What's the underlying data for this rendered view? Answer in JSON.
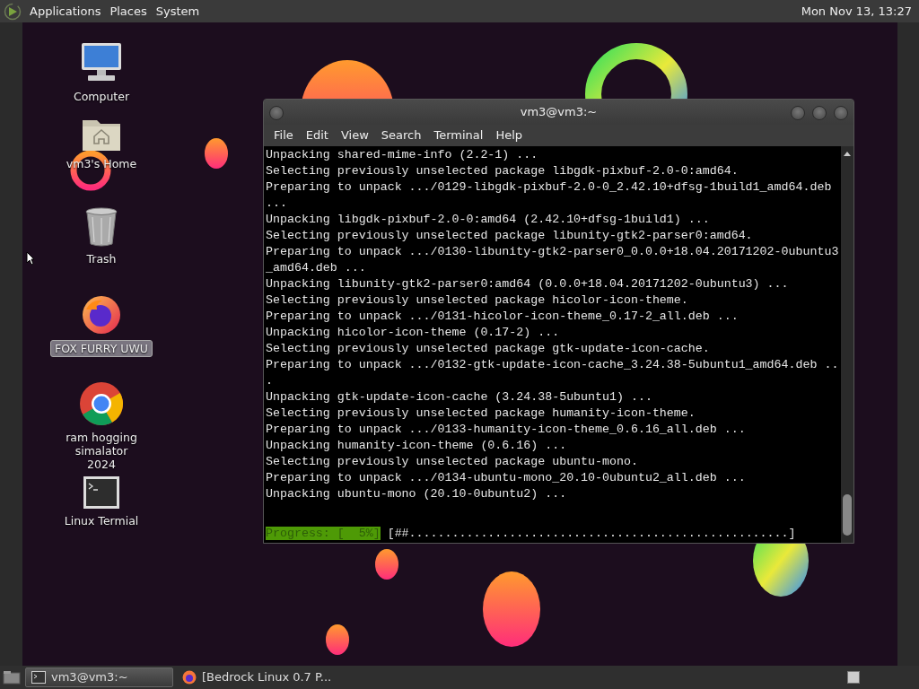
{
  "top_panel": {
    "menus": [
      "Applications",
      "Places",
      "System"
    ],
    "clock": "Mon Nov 13, 13:27"
  },
  "desktop_icons": [
    {
      "label": "Computer",
      "kind": "computer",
      "selected": false
    },
    {
      "label": "vm3's Home",
      "kind": "home",
      "selected": false
    },
    {
      "label": "Trash",
      "kind": "trash",
      "selected": false
    },
    {
      "label": "FOX FURRY UWU",
      "kind": "firefox",
      "selected": true
    },
    {
      "label": "ram hogging simalator 2024",
      "kind": "chrome",
      "selected": false
    },
    {
      "label": "Linux Termial",
      "kind": "terminal",
      "selected": false
    }
  ],
  "terminal": {
    "title": "vm3@vm3:~",
    "menu": [
      "File",
      "Edit",
      "View",
      "Search",
      "Terminal",
      "Help"
    ],
    "lines": [
      "Unpacking shared-mime-info (2.2-1) ...",
      "Selecting previously unselected package libgdk-pixbuf-2.0-0:amd64.",
      "Preparing to unpack .../0129-libgdk-pixbuf-2.0-0_2.42.10+dfsg-1build1_amd64.deb",
      "...",
      "Unpacking libgdk-pixbuf-2.0-0:amd64 (2.42.10+dfsg-1build1) ...",
      "Selecting previously unselected package libunity-gtk2-parser0:amd64.",
      "Preparing to unpack .../0130-libunity-gtk2-parser0_0.0.0+18.04.20171202-0ubuntu3",
      "_amd64.deb ...",
      "Unpacking libunity-gtk2-parser0:amd64 (0.0.0+18.04.20171202-0ubuntu3) ...",
      "Selecting previously unselected package hicolor-icon-theme.",
      "Preparing to unpack .../0131-hicolor-icon-theme_0.17-2_all.deb ...",
      "Unpacking hicolor-icon-theme (0.17-2) ...",
      "Selecting previously unselected package gtk-update-icon-cache.",
      "Preparing to unpack .../0132-gtk-update-icon-cache_3.24.38-5ubuntu1_amd64.deb ..",
      ".",
      "Unpacking gtk-update-icon-cache (3.24.38-5ubuntu1) ...",
      "Selecting previously unselected package humanity-icon-theme.",
      "Preparing to unpack .../0133-humanity-icon-theme_0.6.16_all.deb ...",
      "Unpacking humanity-icon-theme (0.6.16) ...",
      "Selecting previously unselected package ubuntu-mono.",
      "Preparing to unpack .../0134-ubuntu-mono_20.10-0ubuntu2_all.deb ...",
      "Unpacking ubuntu-mono (20.10-0ubuntu2) ..."
    ],
    "progress_label": "Progress: [  5%]",
    "progress_bar": "[##.....................................................]"
  },
  "taskbar": {
    "tasks": [
      {
        "label": "vm3@vm3:~",
        "kind": "terminal",
        "selected": true
      },
      {
        "label": "[Bedrock Linux 0.7 P...",
        "kind": "firefox",
        "selected": false
      }
    ]
  }
}
